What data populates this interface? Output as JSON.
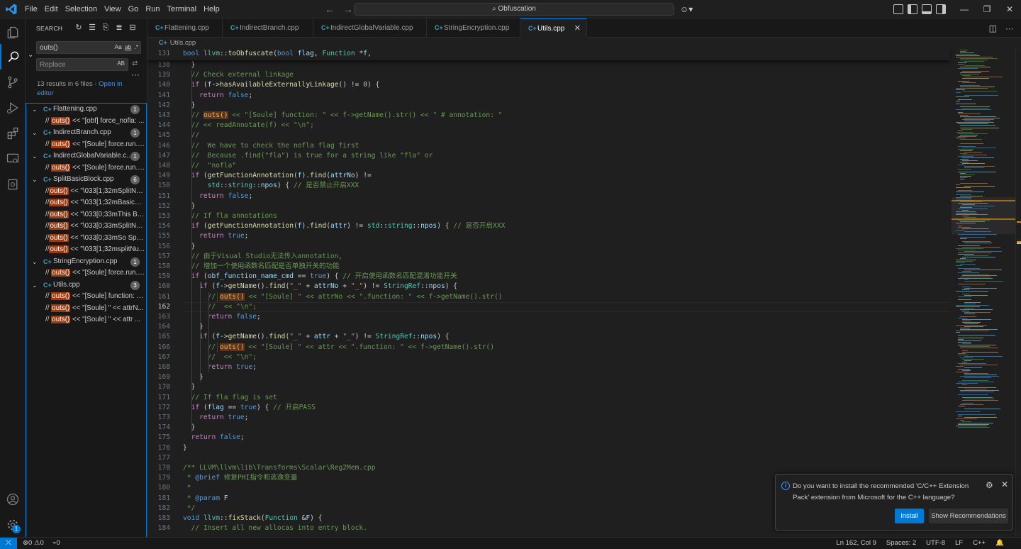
{
  "menu": [
    "File",
    "Edit",
    "Selection",
    "View",
    "Go",
    "Run",
    "Terminal",
    "Help"
  ],
  "command_center": {
    "text": "Obfuscation",
    "icon": "search-icon"
  },
  "window_controls": [
    "minimize",
    "restore",
    "close"
  ],
  "sidebar": {
    "title": "SEARCH",
    "search_value": "outs()",
    "search_options": [
      "Aa",
      "ab",
      ".*"
    ],
    "replace_placeholder": "Replace",
    "replace_option": "AB",
    "results_text": "13 results in 6 files - ",
    "open_in_editor": "Open in editor",
    "results": [
      {
        "file": "Flattening.cpp",
        "count": "1",
        "matches": [
          {
            "pre": "// ",
            "hit": "outs()",
            "post": " << \"[obf] force_nofla: ..."
          }
        ]
      },
      {
        "file": "IndirectBranch.cpp",
        "count": "1",
        "matches": [
          {
            "pre": "// ",
            "hit": "outs()",
            "post": " << \"[Soule] force.run.I..."
          }
        ]
      },
      {
        "file": "IndirectGlobalVariable.c...",
        "count": "1",
        "matches": [
          {
            "pre": "// ",
            "hit": "outs()",
            "post": " << \"[Soule] force.run.I..."
          }
        ]
      },
      {
        "file": "SplitBasicBlock.cpp",
        "count": "6",
        "matches": [
          {
            "pre": "//",
            "hit": "outs()",
            "post": " << \"\\033[1;32mSplitNu..."
          },
          {
            "pre": "//",
            "hit": "outs()",
            "post": " << \"\\033[1;32mBasicBl..."
          },
          {
            "pre": "//",
            "hit": "outs()",
            "post": " << \"\\033[0;33mThis Ba..."
          },
          {
            "pre": "//",
            "hit": "outs()",
            "post": " << \"\\033[0;33mSplitNu..."
          },
          {
            "pre": "//",
            "hit": "outs()",
            "post": " << \"\\033[0;33mSo Spli..."
          },
          {
            "pre": "//",
            "hit": "outs()",
            "post": " << \"\\033[1;32msplitNu..."
          }
        ]
      },
      {
        "file": "StringEncryption.cpp",
        "count": "1",
        "matches": [
          {
            "pre": "// ",
            "hit": "outs()",
            "post": " << \"[Soule] force.run.S..."
          }
        ]
      },
      {
        "file": "Utils.cpp",
        "count": "3",
        "matches": [
          {
            "pre": "// ",
            "hit": "outs()",
            "post": " << \"[Soule] function: \"..."
          },
          {
            "pre": "// ",
            "hit": "outs()",
            "post": " << \"[Soule] \" << attrN..."
          },
          {
            "pre": "// ",
            "hit": "outs()",
            "post": " << \"[Soule] \" << attr ..."
          }
        ]
      }
    ]
  },
  "tabs": [
    {
      "label": "Flattening.cpp",
      "active": false
    },
    {
      "label": "IndirectBranch.cpp",
      "active": false
    },
    {
      "label": "IndirectGlobalVariable.cpp",
      "active": false
    },
    {
      "label": "StringEncryption.cpp",
      "active": false
    },
    {
      "label": "Utils.cpp",
      "active": true
    }
  ],
  "breadcrumb": "Utils.cpp",
  "editor": {
    "current_line": "162",
    "sticky": {
      "num": "131",
      "html": "<span class=\"kw\">bool</span> <span class=\"ty\">llvm</span>::<span class=\"fn\">toObfuscate</span>(<span class=\"kw\">bool</span> <span class=\"va\">flag</span>, <span class=\"ty\">Function</span> *<span class=\"va\">f</span>,"
    },
    "lines": [
      {
        "num": "138",
        "html": "  }"
      },
      {
        "num": "139",
        "html": "  <span class=\"cm\">// Check external linkage</span>"
      },
      {
        "num": "140",
        "html": "  <span class=\"ct\">if</span> (<span class=\"va\">f</span>-&gt;<span class=\"fn\">hasAvailableExternallyLinkage</span>() != <span class=\"nu\">0</span>) {"
      },
      {
        "num": "141",
        "html": "    <span class=\"ct\">return</span> <span class=\"kw\">false</span>;"
      },
      {
        "num": "142",
        "html": "  }"
      },
      {
        "num": "143",
        "html": "  <span class=\"cm\">// <span class=\"hl\">outs()</span> &lt;&lt; \"[Soule] function: \" &lt;&lt; f-&gt;getName().str() &lt;&lt; \" # annotation: \"</span>"
      },
      {
        "num": "144",
        "html": "  <span class=\"cm\">// &lt;&lt; readAnnotate(f) &lt;&lt; \"\\n\";</span>"
      },
      {
        "num": "145",
        "html": "  <span class=\"cm\">//</span>"
      },
      {
        "num": "146",
        "html": "  <span class=\"cm\">//  We have to check the nofla flag first</span>"
      },
      {
        "num": "147",
        "html": "  <span class=\"cm\">//  Because .find(\"fla\") is true for a string like \"fla\" or</span>"
      },
      {
        "num": "148",
        "html": "  <span class=\"cm\">//  \"nofla\"</span>"
      },
      {
        "num": "149",
        "html": "  <span class=\"ct\">if</span> (<span class=\"fn\">getFunctionAnnotation</span>(<span class=\"va\">f</span>).<span class=\"fn\">find</span>(<span class=\"va\">attrNo</span>) !="
      },
      {
        "num": "150",
        "html": "      <span class=\"ty\">std</span>::<span class=\"ty\">string</span>::<span class=\"va\">npos</span>) { <span class=\"cm\">// 是否禁止开启XXX</span>"
      },
      {
        "num": "151",
        "html": "    <span class=\"ct\">return</span> <span class=\"kw\">false</span>;"
      },
      {
        "num": "152",
        "html": "  }"
      },
      {
        "num": "153",
        "html": "  <span class=\"cm\">// If fla annotations</span>"
      },
      {
        "num": "154",
        "html": "  <span class=\"ct\">if</span> (<span class=\"fn\">getFunctionAnnotation</span>(<span class=\"va\">f</span>).<span class=\"fn\">find</span>(<span class=\"va\">attr</span>) != <span class=\"ty\">std</span>::<span class=\"ty\">string</span>::<span class=\"va\">npos</span>) { <span class=\"cm\">// 是否开启XXX</span>"
      },
      {
        "num": "155",
        "html": "    <span class=\"ct\">return</span> <span class=\"kw\">true</span>;"
      },
      {
        "num": "156",
        "html": "  }"
      },
      {
        "num": "157",
        "html": "  <span class=\"cm\">// 由于Visual Studio无法传入annotation,</span>"
      },
      {
        "num": "158",
        "html": "  <span class=\"cm\">// 增加一个使用函数名匹配是否单独开关的功能</span>"
      },
      {
        "num": "159",
        "html": "  <span class=\"ct\">if</span> (<span class=\"va\">obf_function_name_cmd</span> == <span class=\"kw\">true</span>) { <span class=\"cm\">// 开启使用函数名匹配混淆功能开关</span>"
      },
      {
        "num": "160",
        "html": "    <span class=\"ct\">if</span> (<span class=\"va\">f</span>-&gt;<span class=\"fn\">getName</span>().<span class=\"fn\">find</span>(<span class=\"st\">\"_\"</span> + <span class=\"va\">attrNo</span> + <span class=\"st\">\"_\"</span>) != <span class=\"ty\">StringRef</span>::<span class=\"va\">npos</span>) {"
      },
      {
        "num": "161",
        "html": "      <span class=\"cm\">// <span class=\"hl\">outs()</span> &lt;&lt; \"[Soule] \" &lt;&lt; attrNo &lt;&lt; \".function: \" &lt;&lt; f-&gt;getName().str()</span>"
      },
      {
        "num": "162",
        "html": "      <span class=\"cm\">//  &lt;&lt; \"\\n\";</span>"
      },
      {
        "num": "163",
        "html": "      <span class=\"ct\">return</span> <span class=\"kw\">false</span>;"
      },
      {
        "num": "164",
        "html": "    }"
      },
      {
        "num": "165",
        "html": "    <span class=\"ct\">if</span> (<span class=\"va\">f</span>-&gt;<span class=\"fn\">getName</span>().<span class=\"fn\">find</span>(<span class=\"st\">\"_\"</span> + <span class=\"va\">attr</span> + <span class=\"st\">\"_\"</span>) != <span class=\"ty\">StringRef</span>::<span class=\"va\">npos</span>) {"
      },
      {
        "num": "166",
        "html": "      <span class=\"cm\">// <span class=\"hl\">outs()</span> &lt;&lt; \"[Soule] \" &lt;&lt; attr &lt;&lt; \".function: \" &lt;&lt; f-&gt;getName().str()</span>"
      },
      {
        "num": "167",
        "html": "      <span class=\"cm\">//  &lt;&lt; \"\\n\";</span>"
      },
      {
        "num": "168",
        "html": "      <span class=\"ct\">return</span> <span class=\"kw\">true</span>;"
      },
      {
        "num": "169",
        "html": "    }"
      },
      {
        "num": "170",
        "html": "  }"
      },
      {
        "num": "171",
        "html": "  <span class=\"cm\">// If fla flag is set</span>"
      },
      {
        "num": "172",
        "html": "  <span class=\"ct\">if</span> (<span class=\"va\">flag</span> == <span class=\"kw\">true</span>) { <span class=\"cm\">// 开启PASS</span>"
      },
      {
        "num": "173",
        "html": "    <span class=\"ct\">return</span> <span class=\"kw\">true</span>;"
      },
      {
        "num": "174",
        "html": "  }"
      },
      {
        "num": "175",
        "html": "  <span class=\"ct\">return</span> <span class=\"kw\">false</span>;"
      },
      {
        "num": "176",
        "html": "}"
      },
      {
        "num": "177",
        "html": ""
      },
      {
        "num": "178",
        "html": "<span class=\"cm\">/** LLVM\\llvm\\lib\\Transforms\\Scalar\\Reg2Mem.cpp</span>"
      },
      {
        "num": "179",
        "html": "<span class=\"cm\"> * <span class=\"dockw\">@brief</span> 修复PHI指令和逃逸变量</span>"
      },
      {
        "num": "180",
        "html": "<span class=\"cm\"> *</span>"
      },
      {
        "num": "181",
        "html": "<span class=\"cm\"> * <span class=\"dockw\">@param</span> <span class=\"va\">F</span></span>"
      },
      {
        "num": "182",
        "html": "<span class=\"cm\"> */</span>"
      },
      {
        "num": "183",
        "html": "<span class=\"kw\">void</span> <span class=\"ty\">llvm</span>::<span class=\"fn\">fixStack</span>(<span class=\"ty\">Function</span> &amp;<span class=\"va\">F</span>) {"
      },
      {
        "num": "184",
        "html": "  <span class=\"cm\">// Insert all new allocas into entry block.</span>"
      }
    ]
  },
  "notification": {
    "message": "Do you want to install the recommended 'C/C++ Extension Pack' extension from Microsoft for the C++ language?",
    "install": "Install",
    "show_recommendations": "Show Recommendations"
  },
  "status": {
    "errors": "0",
    "warnings": "0",
    "ports": "0",
    "position": "Ln 162, Col 9",
    "spaces": "Spaces: 2",
    "encoding": "UTF-8",
    "eol": "LF",
    "language": "C++"
  },
  "colors": {
    "accent": "#0078d4",
    "match_highlight": "#623315",
    "background": "#1f1f1f"
  }
}
